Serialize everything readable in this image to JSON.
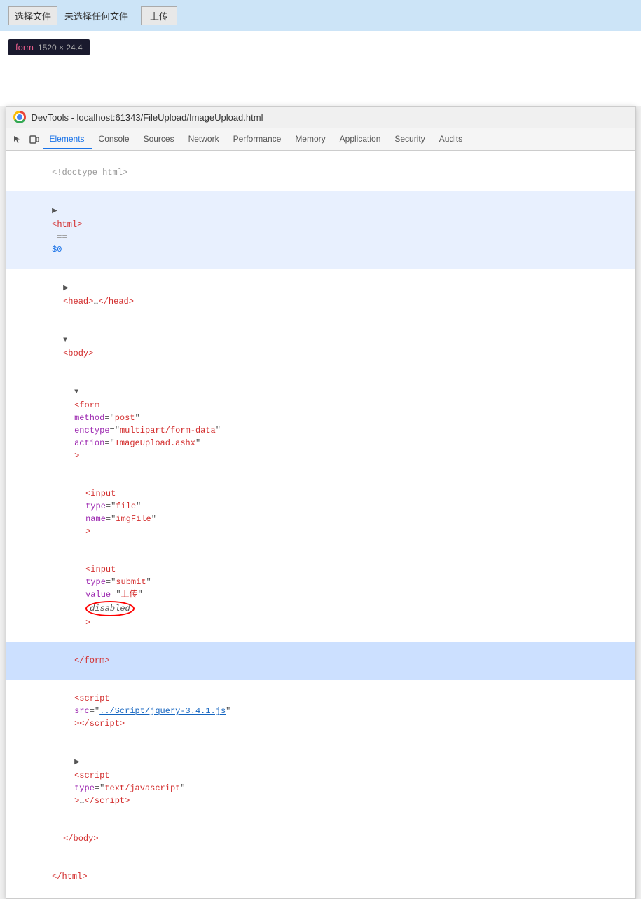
{
  "topBar": {
    "chooseBtnLabel": "选择文件",
    "noFileLabel": "未选择任何文件",
    "uploadBtnLabel": "上传"
  },
  "formTooltip": {
    "tag": "form",
    "size": "1520 × 24.4"
  },
  "devtools": {
    "title": "DevTools - localhost:61343/FileUpload/ImageUpload.html",
    "tabs": [
      "Elements",
      "Console",
      "Sources",
      "Network",
      "Performance",
      "Memory",
      "Application",
      "Security",
      "Audits"
    ],
    "activeTab": "Elements"
  },
  "codeLines": [
    {
      "id": 1,
      "text": "<!doctype html>",
      "type": "normal",
      "indent": 0
    },
    {
      "id": 2,
      "text": "<html> == $0",
      "type": "highlighted",
      "indent": 0
    },
    {
      "id": 3,
      "text": "▶ <head>…</head>",
      "type": "normal",
      "indent": 1
    },
    {
      "id": 4,
      "text": "▼ <body>",
      "type": "normal",
      "indent": 1
    },
    {
      "id": 5,
      "type": "form-line",
      "indent": 2
    },
    {
      "id": 6,
      "type": "input-file",
      "indent": 3
    },
    {
      "id": 7,
      "type": "input-submit",
      "indent": 3
    },
    {
      "id": 8,
      "text": "</form>",
      "type": "selected",
      "indent": 2
    },
    {
      "id": 9,
      "type": "script-jquery",
      "indent": 2
    },
    {
      "id": 10,
      "type": "script-js",
      "indent": 2
    },
    {
      "id": 11,
      "text": "</body>",
      "type": "normal",
      "indent": 1
    },
    {
      "id": 12,
      "text": "</html>",
      "type": "normal",
      "indent": 0
    }
  ]
}
